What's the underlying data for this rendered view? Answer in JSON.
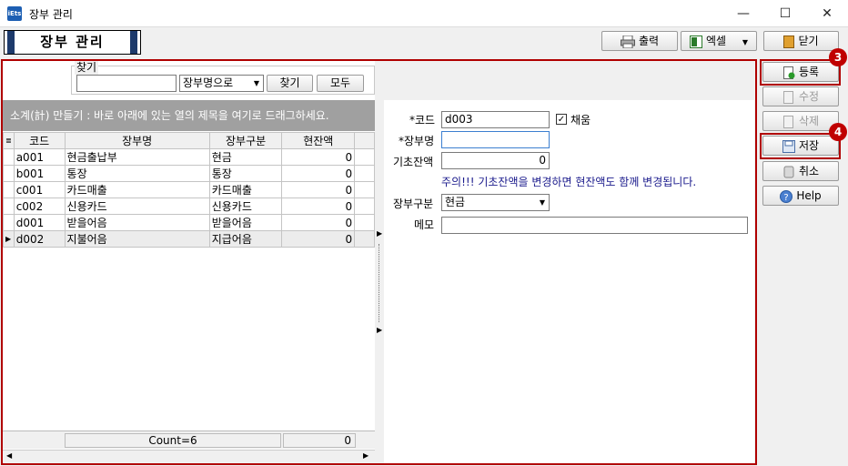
{
  "window": {
    "title": "장부 관리",
    "app_icon_text": "iEts",
    "minimize": "—",
    "maximize": "☐",
    "close": "✕"
  },
  "banner": {
    "title": "장부 관리"
  },
  "toolbar": {
    "print_label": "출력",
    "excel_label": "엑셀",
    "close_label": "닫기"
  },
  "search": {
    "group_label": "찾기",
    "input_value": "",
    "mode_value": "장부명으로",
    "find_label": "찾기",
    "all_label": "모두"
  },
  "grid": {
    "group_hint": "소계(計) 만들기 : 바로 아래에 있는 열의 제목을 여기로 드래그하세요.",
    "headers": [
      "코드",
      "장부명",
      "장부구분",
      "현잔액"
    ],
    "rows": [
      {
        "code": "a001",
        "name": "현금출납부",
        "type": "현금",
        "balance": "0"
      },
      {
        "code": "b001",
        "name": "통장",
        "type": "통장",
        "balance": "0"
      },
      {
        "code": "c001",
        "name": "카드매출",
        "type": "카드매출",
        "balance": "0"
      },
      {
        "code": "c002",
        "name": "신용카드",
        "type": "신용카드",
        "balance": "0"
      },
      {
        "code": "d001",
        "name": "받을어음",
        "type": "받을어음",
        "balance": "0"
      },
      {
        "code": "d002",
        "name": "지불어음",
        "type": "지급어음",
        "balance": "0"
      }
    ],
    "footer_count": "Count=6",
    "footer_sum": "0"
  },
  "form": {
    "code_label": "*코드",
    "code_value": "d003",
    "auto_label": "채움",
    "auto_checked": "✓",
    "name_label": "*장부명",
    "name_value": "",
    "opening_label": "기초잔액",
    "opening_value": "0",
    "notice": "주의!!! 기초잔액을 변경하면 현잔액도 함께 변경됩니다.",
    "type_label": "장부구분",
    "type_value": "현금",
    "memo_label": "메모",
    "memo_value": ""
  },
  "side": {
    "register_label": "등록",
    "edit_label": "수정",
    "delete_label": "삭제",
    "save_label": "저장",
    "cancel_label": "취소",
    "help_label": "Help",
    "badge_register": "3",
    "badge_save": "4"
  },
  "colors": {
    "highlight_frame": "#b00000",
    "notice_text": "#1a1a8c"
  }
}
